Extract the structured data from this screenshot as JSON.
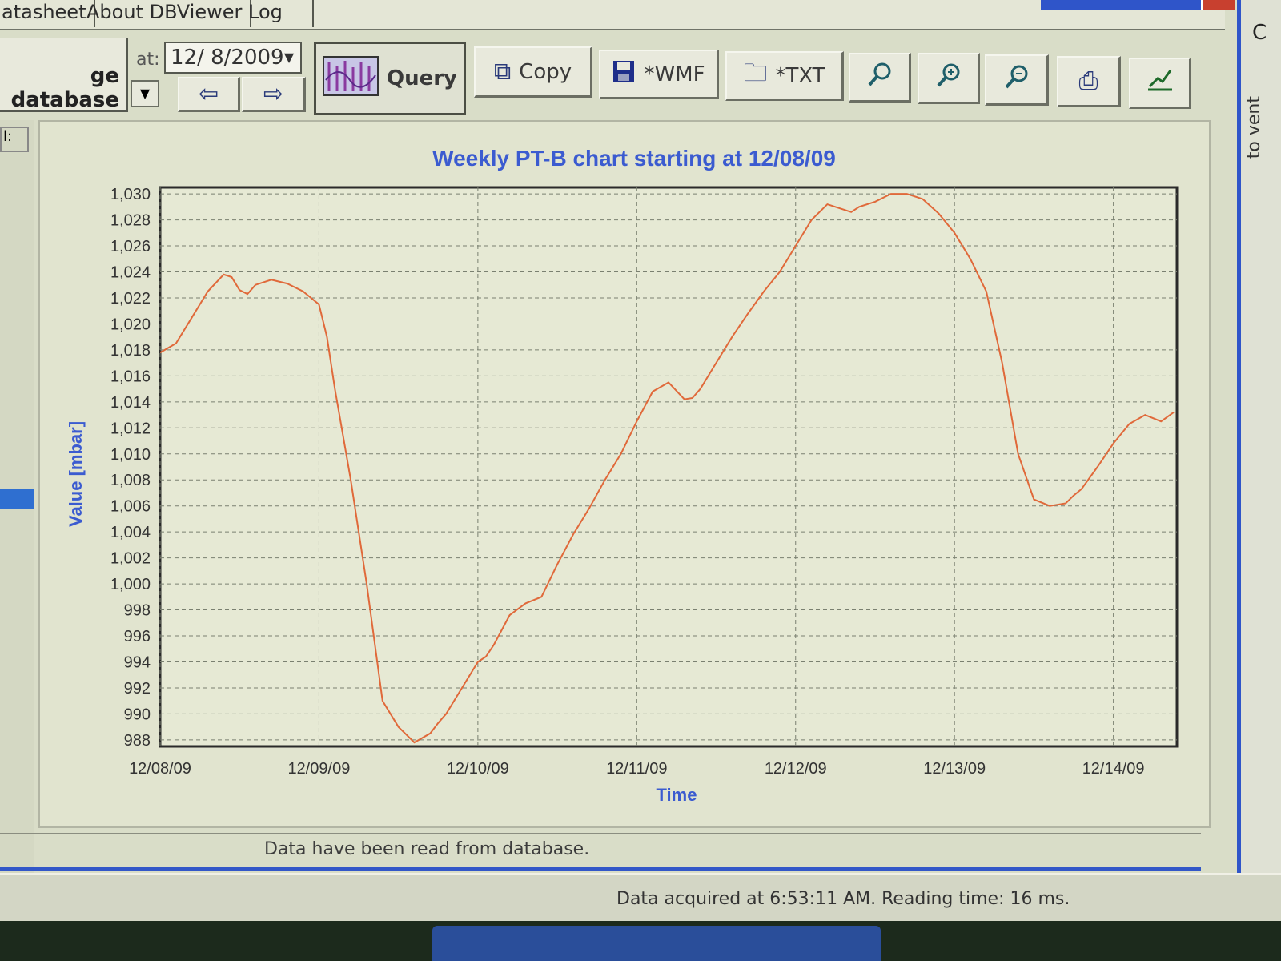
{
  "tabs": [
    "atasheet",
    "About DBViewer",
    "Log"
  ],
  "toolbar": {
    "db_button": "ge database",
    "at_label": "at:",
    "date_value": "12/ 8/2009",
    "query": "Query",
    "copy": "Copy",
    "wmf": "*WMF",
    "txt": "*TXT"
  },
  "right_strip": {
    "c": "C",
    "vertical": "to vent"
  },
  "icons": [
    "chevron-down-icon",
    "arrow-left-icon",
    "arrow-right-icon",
    "chart-icon",
    "copy-icon",
    "save-icon",
    "folder-icon",
    "search-icon",
    "zoom-in-icon",
    "zoom-out-icon",
    "print-icon",
    "chart-settings-icon"
  ],
  "colors": {
    "title": "#3b5bd0",
    "series": "#e0693a",
    "grid": "#7a8070",
    "window_blue": "#2f55c9"
  },
  "chart_data": {
    "type": "line",
    "title": "Weekly PT-B chart starting at 12/08/09",
    "xlabel": "Time",
    "ylabel": "Value [mbar]",
    "x_ticks": [
      "12/08/09",
      "12/09/09",
      "12/10/09",
      "12/11/09",
      "12/12/09",
      "12/13/09",
      "12/14/09"
    ],
    "y_ticks": [
      "1,030",
      "1,028",
      "1,026",
      "1,024",
      "1,022",
      "1,020",
      "1,018",
      "1,016",
      "1,014",
      "1,012",
      "1,010",
      "1,008",
      "1,006",
      "1,004",
      "1,002",
      "1,000",
      "998",
      "996",
      "994",
      "992",
      "990",
      "988"
    ],
    "ylim": [
      987.5,
      1030.5
    ],
    "xlim": [
      0,
      6.4
    ],
    "grid": true,
    "series": [
      {
        "x": [
          0,
          0.1,
          0.2,
          0.3,
          0.4,
          0.45,
          0.5,
          0.55,
          0.6,
          0.7,
          0.8,
          0.9,
          1.0,
          1.05,
          1.1,
          1.2,
          1.3,
          1.4,
          1.5,
          1.6,
          1.7,
          1.75,
          1.8,
          1.9,
          2.0,
          2.05,
          2.1,
          2.2,
          2.3,
          2.4,
          2.5,
          2.6,
          2.7,
          2.8,
          2.9,
          3.0,
          3.1,
          3.2,
          3.3,
          3.35,
          3.4,
          3.5,
          3.6,
          3.7,
          3.8,
          3.9,
          4.0,
          4.1,
          4.2,
          4.3,
          4.35,
          4.4,
          4.5,
          4.6,
          4.7,
          4.8,
          4.9,
          5.0,
          5.1,
          5.2,
          5.3,
          5.4,
          5.5,
          5.6,
          5.7,
          5.75,
          5.8,
          5.9,
          6.0,
          6.1,
          6.2,
          6.3,
          6.38
        ],
        "y": [
          1017.8,
          1018.5,
          1020.5,
          1022.5,
          1023.8,
          1023.6,
          1022.6,
          1022.3,
          1023.0,
          1023.4,
          1023.1,
          1022.5,
          1021.5,
          1019.0,
          1015.0,
          1008.0,
          1000.0,
          991.0,
          989.0,
          987.8,
          988.5,
          989.3,
          990.0,
          992.0,
          994.0,
          994.4,
          995.3,
          997.6,
          998.5,
          999.0,
          1001.5,
          1003.8,
          1005.8,
          1008.0,
          1010.0,
          1012.5,
          1014.8,
          1015.5,
          1014.2,
          1014.3,
          1015.0,
          1017.0,
          1019.0,
          1020.8,
          1022.5,
          1024.0,
          1026.0,
          1028.0,
          1029.2,
          1028.8,
          1028.6,
          1029.0,
          1029.4,
          1030.0,
          1030.0,
          1029.6,
          1028.5,
          1027.0,
          1025.0,
          1022.5,
          1017.0,
          1010.0,
          1006.5,
          1006.0,
          1006.2,
          1006.8,
          1007.3,
          1009.0,
          1010.8,
          1012.3,
          1013.0,
          1012.5,
          1013.2
        ]
      }
    ]
  },
  "status": {
    "message": "Data have been read from database.",
    "acquired": "Data acquired at 6:53:11 AM. Reading time: 16 ms."
  }
}
